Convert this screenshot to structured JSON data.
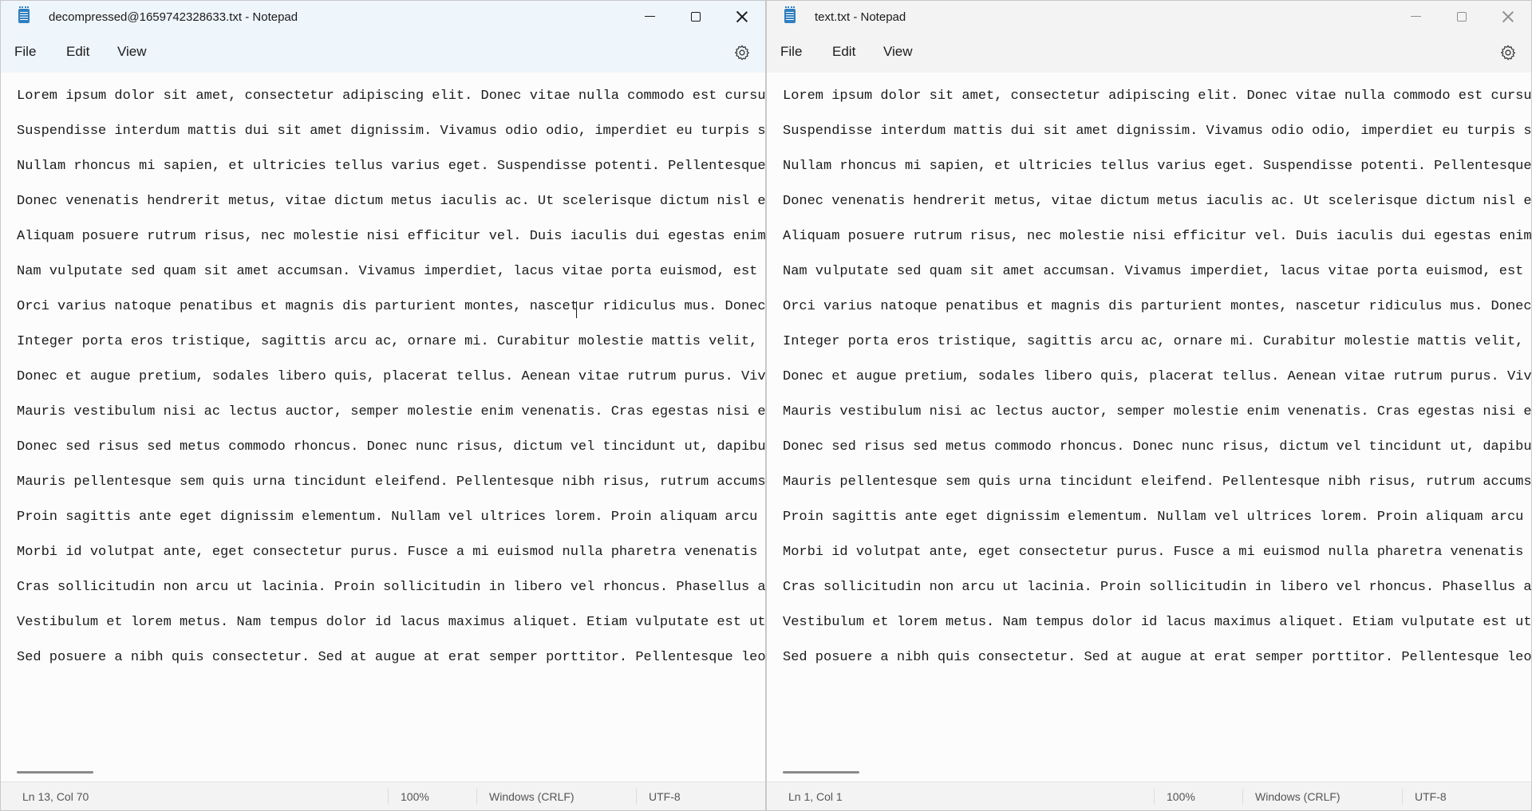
{
  "lines": [
    "Lorem ipsum dolor sit amet, consectetur adipiscing elit. Donec vitae nulla commodo est cursus",
    "Suspendisse interdum mattis dui sit amet dignissim. Vivamus odio odio, imperdiet eu turpis sit",
    "Nullam rhoncus mi sapien, et ultricies tellus varius eget. Suspendisse potenti. Pellentesque h",
    "Donec venenatis hendrerit metus, vitae dictum metus iaculis ac. Ut scelerisque dictum nisl ege",
    "Aliquam posuere rutrum risus, nec molestie nisi efficitur vel. Duis iaculis dui egestas enim a",
    "Nam vulputate sed quam sit amet accumsan. Vivamus imperdiet, lacus vitae porta euismod, est ni",
    "Orci varius natoque penatibus et magnis dis parturient montes, nascetur ridiculus mus. Donec e",
    "Integer porta eros tristique, sagittis arcu ac, ornare mi. Curabitur molestie mattis velit, a",
    "Donec et augue pretium, sodales libero quis, placerat tellus. Aenean vitae rutrum purus. Vivam",
    "Mauris vestibulum nisi ac lectus auctor, semper molestie enim venenatis. Cras egestas nisi et",
    "Donec sed risus sed metus commodo rhoncus. Donec nunc risus, dictum vel tincidunt ut, dapibus",
    "Mauris pellentesque sem quis urna tincidunt eleifend. Pellentesque nibh risus, rutrum accumsan",
    "Proin sagittis ante eget dignissim elementum. Nullam vel ultrices lorem. Proin aliquam arcu in",
    "Morbi id volutpat ante, eget consectetur purus. Fusce a mi euismod nulla pharetra venenatis ut",
    "Cras sollicitudin non arcu ut lacinia. Proin sollicitudin in libero vel rhoncus. Phasellus ac",
    "Vestibulum et lorem metus. Nam tempus dolor id lacus maximus aliquet. Etiam vulputate est ut n",
    "Sed posuere a nibh quis consectetur. Sed at augue at erat semper porttitor. Pellentesque leo l"
  ],
  "left": {
    "title": "decompressed@1659742328633.txt - Notepad",
    "menu": {
      "file": "File",
      "edit": "Edit",
      "view": "View"
    },
    "status": {
      "position": "Ln 13, Col 70",
      "zoom": "100%",
      "line_ending": "Windows (CRLF)",
      "encoding": "UTF-8"
    },
    "active": true
  },
  "right": {
    "title": "text.txt - Notepad",
    "menu": {
      "file": "File",
      "edit": "Edit",
      "view": "View"
    },
    "status": {
      "position": "Ln 1, Col 1",
      "zoom": "100%",
      "line_ending": "Windows (CRLF)",
      "encoding": "UTF-8"
    },
    "active": false
  },
  "icons": {
    "app": "notepad-icon",
    "minimize": "minimize-icon",
    "maximize": "maximize-icon",
    "close": "close-icon",
    "settings": "gear-icon"
  }
}
